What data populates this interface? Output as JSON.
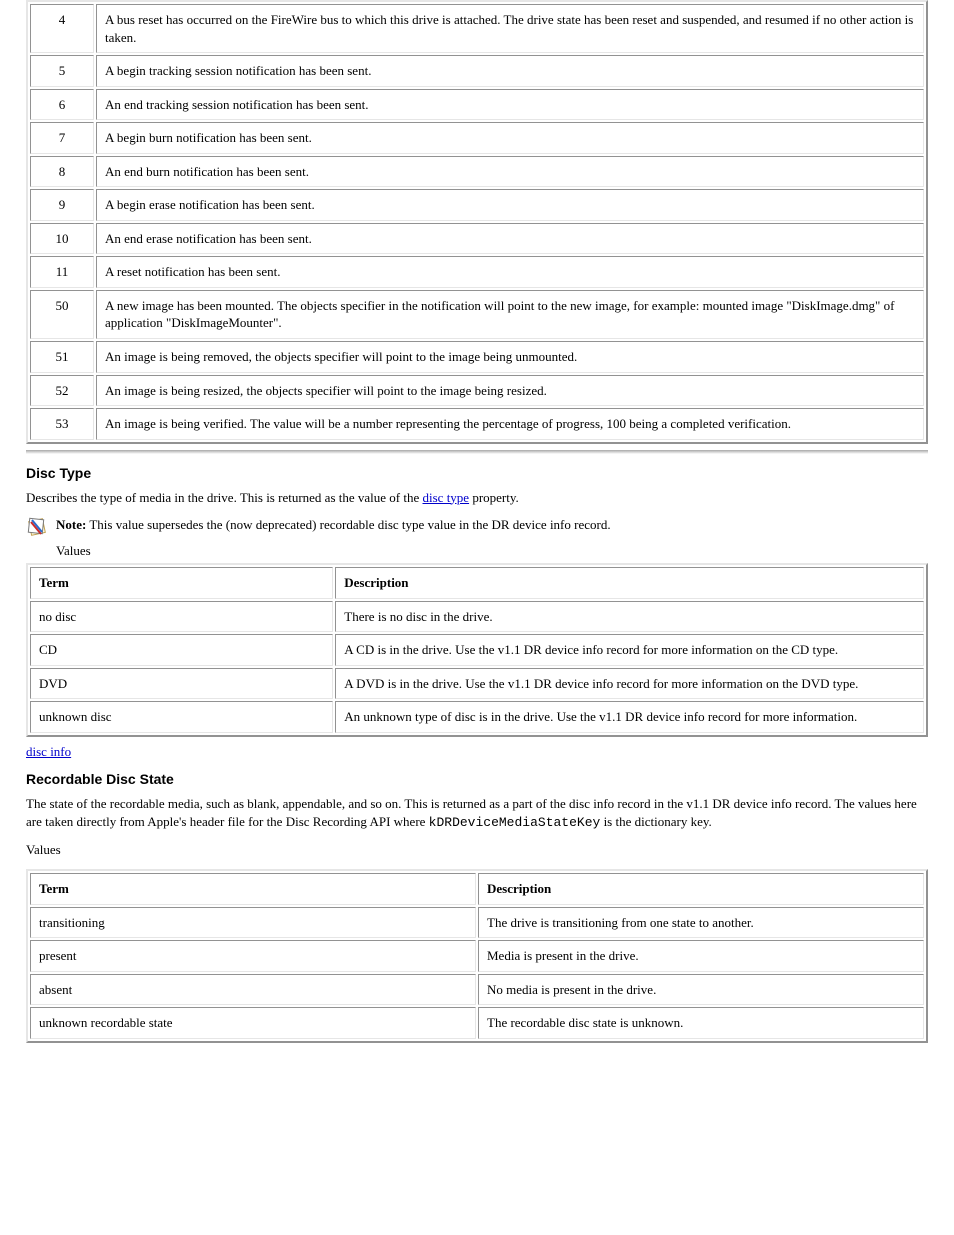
{
  "notifications_table": {
    "rows": [
      {
        "n": "4",
        "desc": "A bus reset has occurred on the FireWire bus to which this drive is attached. The drive state has been reset and suspended, and resumed if no other action is taken."
      },
      {
        "n": "5",
        "desc": "A begin tracking session notification has been sent."
      },
      {
        "n": "6",
        "desc": "An end tracking session notification has been sent."
      },
      {
        "n": "7",
        "desc": "A begin burn notification has been sent."
      },
      {
        "n": "8",
        "desc": "An end burn notification has been sent."
      },
      {
        "n": "9",
        "desc": "A begin erase notification has been sent."
      },
      {
        "n": "10",
        "desc": "An end erase notification has been sent."
      },
      {
        "n": "11",
        "desc": "A reset notification has been sent."
      },
      {
        "n": "50",
        "desc": "A new image has been mounted. The objects specifier in the notification will point to the new image, for example: mounted image \"DiskImage.dmg\" of application \"DiskImageMounter\"."
      },
      {
        "n": "51",
        "desc": "An image is being removed, the objects specifier will point to the image being unmounted."
      },
      {
        "n": "52",
        "desc": "An image is being resized, the objects specifier will point to the image being resized."
      },
      {
        "n": "53",
        "desc": "An image is being verified. The value will be a number representing the percentage of progress, 100 being a completed verification."
      }
    ]
  },
  "dtype_section": {
    "heading": "Disc Type",
    "intro_pre": "Describes the type of media in the drive. This is returned as the value of the ",
    "intro_link": "disc type",
    "intro_post": " property.",
    "note_strong": "Note:",
    "note_body": "This value supersedes the (now deprecated) recordable disc type value in the DR device info record.",
    "table": {
      "headers": [
        "Term",
        "Description"
      ],
      "rows": [
        [
          "no disc",
          "There is no disc in the drive."
        ],
        [
          "CD",
          "A CD is in the drive. Use the v1.1 DR device info record for more information on the CD type."
        ],
        [
          "DVD",
          "A DVD is in the drive. Use the v1.1 DR device info record for more information on the DVD type."
        ],
        [
          "unknown disc",
          "An unknown type of disc is in the drive. Use the v1.1 DR device info record for more information."
        ]
      ]
    }
  },
  "rstate_section": {
    "heading": "Recordable Disc State",
    "intro_pre": "The state of the recordable media, such as blank, appendable, and so on. This is returned as a part of the disc info record in the v1.1 DR device info record. The values here are taken directly from Apple's header file for the Disc Recording API where ",
    "intro_code": "kDRDeviceMediaStateKey",
    "intro_post": " is the dictionary key.",
    "link_text": "disc info",
    "table": {
      "headers": [
        "Term",
        "Description"
      ],
      "rows": [
        [
          "transitioning",
          "The drive is transitioning from one state to another."
        ],
        [
          "present",
          "Media is present in the drive."
        ],
        [
          "absent",
          "No media is present in the drive."
        ],
        [
          "unknown recordable state",
          "The recordable disc state is unknown."
        ]
      ]
    }
  }
}
